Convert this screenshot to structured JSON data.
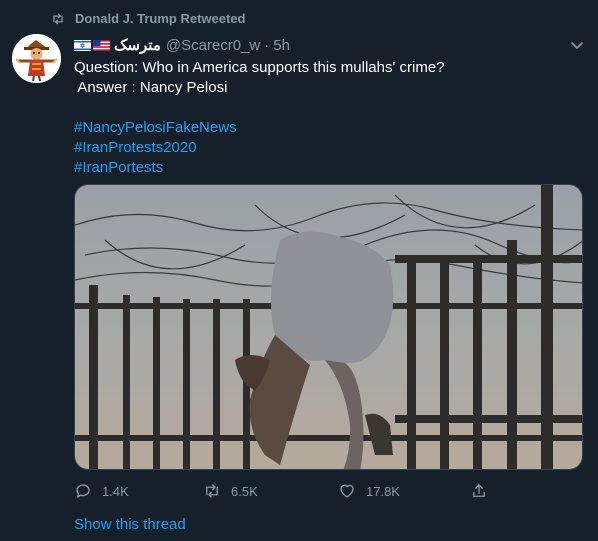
{
  "retweet_context": {
    "label": "Donald J. Trump Retweeted",
    "icon": "retweet-icon"
  },
  "tweet": {
    "author": {
      "display_name": "مترسک",
      "handle": "@Scarecr0_w",
      "flags": [
        "israel-flag-icon",
        "us-flag-icon"
      ]
    },
    "separator": "·",
    "time": "5h",
    "text_lines": [
      "Question: Who in America supports this mullahs' crime?",
      " Answer : Nancy Pelosi",
      ""
    ],
    "hashtags": [
      "#NancyPelosiFakeNews",
      "#IranProtests2020",
      "#IranPortests"
    ],
    "actions": {
      "replies": "1.4K",
      "retweets": "6.5K",
      "likes": "17.8K"
    },
    "show_thread": "Show this thread"
  },
  "colors": {
    "background": "#15202b",
    "secondary_text": "#8899a6",
    "link": "#1da1f2",
    "border": "#38444d"
  }
}
